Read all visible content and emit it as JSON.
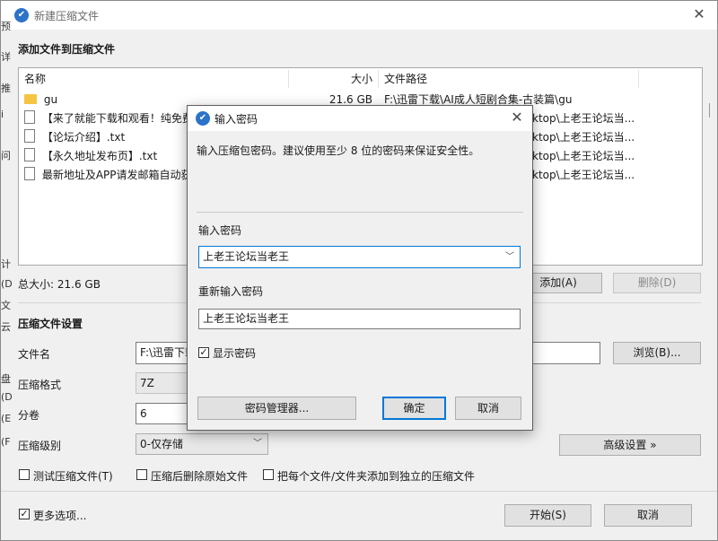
{
  "main": {
    "title": "新建压缩文件",
    "add_files_heading": "添加文件到压缩文件",
    "columns": {
      "name": "名称",
      "size": "大小",
      "path": "文件路径"
    },
    "files": [
      {
        "name": "gu",
        "type": "folder",
        "size": "21.6 GB",
        "path": "F:\\迅雷下载\\AI成人短剧合集-古装篇\\gu"
      },
      {
        "name": "【来了就能下载和观看！纯免费",
        "type": "file",
        "size": "",
        "path": "ktop\\上老王论坛当..."
      },
      {
        "name": "【论坛介绍】.txt",
        "type": "file",
        "size": "",
        "path": "ktop\\上老王论坛当..."
      },
      {
        "name": "【永久地址发布页】.txt",
        "type": "file",
        "size": "",
        "path": "ktop\\上老王论坛当..."
      },
      {
        "name": "最新地址及APP请发邮箱自动获",
        "type": "file",
        "size": "",
        "path": "ktop\\上老王论坛当..."
      }
    ],
    "total_size": "总大小: 21.6 GB",
    "add_button": "添加(A)",
    "delete_button": "删除(D)",
    "settings_heading": "压缩文件设置",
    "filename_label": "文件名",
    "filename_value": "F:\\迅雷下载",
    "browse_button": "浏览(B)...",
    "format_label": "压缩格式",
    "format_value": "7Z",
    "volume_label": "分卷",
    "volume_value": "6",
    "level_label": "压缩级别",
    "level_value": "0-仅存储",
    "advanced_button": "高级设置 »",
    "test_checkbox": "测试压缩文件(T)",
    "delete_after_checkbox": "压缩后删除原始文件",
    "separate_checkbox": "把每个文件/文件夹添加到独立的压缩文件",
    "more_options_checkbox": "更多选项...",
    "start_button": "开始(S)",
    "cancel_button": "取消",
    "left_edge_chars": [
      "预",
      "详",
      "推",
      "i",
      "问",
      "计",
      "(D",
      "文",
      "云",
      "盘",
      "(D",
      "(E",
      "(F"
    ]
  },
  "dialog": {
    "title": "输入密码",
    "instruction": "输入压缩包密码。建议使用至少 8 位的密码来保证安全性。",
    "password_label": "输入密码",
    "password_value": "上老王论坛当老王",
    "reenter_label": "重新输入密码",
    "reenter_value": "上老王论坛当老王",
    "show_password_label": "显示密码",
    "manager_button": "密码管理器...",
    "ok_button": "确定",
    "cancel_button": "取消"
  }
}
